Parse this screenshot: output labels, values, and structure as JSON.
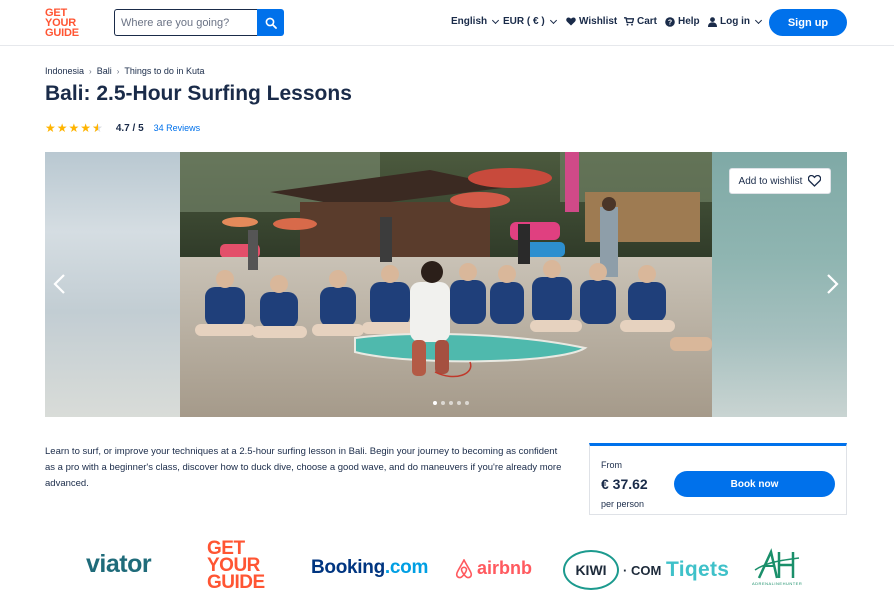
{
  "header": {
    "logo_lines": [
      "GET",
      "YOUR",
      "GUIDE"
    ],
    "search_placeholder": "Where are you going?",
    "language": "English",
    "currency": "EUR ( € )",
    "wishlist": "Wishlist",
    "cart": "Cart",
    "help": "Help",
    "login": "Log in",
    "signup": "Sign up"
  },
  "breadcrumb": [
    "Indonesia",
    "Bali",
    "Things to do in Kuta"
  ],
  "title": "Bali: 2.5-Hour Surfing Lessons",
  "rating": {
    "value_text": "4.7 / 5",
    "reviews": "34 Reviews",
    "stars": 4.7
  },
  "gallery": {
    "wishlist_label": "Add to wishlist",
    "dot_count": 5,
    "active_dot": 0
  },
  "description": "Learn to surf, or improve your techniques at a 2.5-hour surfing lesson in Bali. Begin your journey to becoming as confident as a pro with a beginner's class, discover how to duck dive, choose a good wave, and do maneuvers if you're already more advanced.",
  "booking": {
    "from_label": "From",
    "price": "€ 37.62",
    "per_person": "per person",
    "book_now": "Book now"
  },
  "partners": {
    "viator": "viator",
    "gyg_lines": [
      "GET",
      "YOUR",
      "GUIDE"
    ],
    "booking_main": "Booking",
    "booking_suffix": ".com",
    "airbnb": "airbnb",
    "kiwi_circle": "KIWI",
    "kiwi_suffix": "· COM",
    "tiqets": "Tiqets",
    "adr": "ADRENALINEHUNTER"
  },
  "colors": {
    "brand_orange": "#ff5533",
    "primary_blue": "#0071eb",
    "text_dark": "#1a2b49",
    "star": "#ffb400"
  },
  "icons": {
    "search": "search-icon",
    "heart": "heart-icon",
    "cart": "cart-icon",
    "help": "help-icon",
    "user": "user-icon",
    "arrow_left": "chevron-left-icon",
    "arrow_right": "chevron-right-icon"
  }
}
